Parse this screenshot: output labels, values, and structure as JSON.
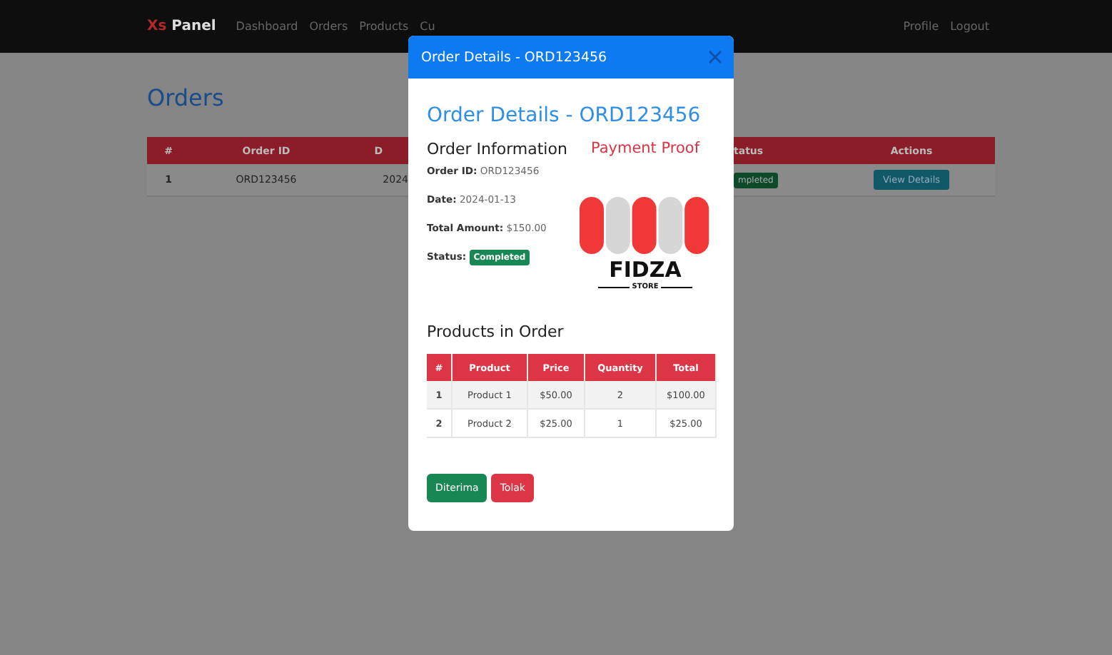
{
  "navbar": {
    "brand_prefix": "Xs",
    "brand": "Panel",
    "links": [
      {
        "label": "Dashboard"
      },
      {
        "label": "Orders"
      },
      {
        "label": "Products"
      },
      {
        "label": "Cu"
      }
    ],
    "right_links": [
      {
        "label": "Profile"
      },
      {
        "label": "Logout"
      }
    ]
  },
  "page_title": "Orders",
  "orders_table": {
    "columns": [
      "#",
      "Order ID",
      "D",
      "tatus",
      "Actions"
    ],
    "rows": [
      {
        "cells": [
          "1",
          "ORD123456",
          "2024"
        ],
        "status": "mpleted",
        "action": "View Details"
      }
    ]
  },
  "modal": {
    "title": "Order Details - ORD123456",
    "heading": "Order Details - ORD123456",
    "info_heading": "Order Information",
    "fields": [
      {
        "label": "Order ID:",
        "value": "ORD123456"
      },
      {
        "label": "Date:",
        "value": "2024-01-13"
      },
      {
        "label": "Total Amount:",
        "value": "$150.00"
      }
    ],
    "status_label": "Status:",
    "status": "Completed",
    "proof_heading": "Payment Proof",
    "logo_name": "FIDZA",
    "logo_sub": "STORE",
    "products_heading": "Products in Order",
    "products_table": {
      "columns": [
        "#",
        "Product",
        "Price",
        "Quantity",
        "Total"
      ],
      "rows": [
        [
          "1",
          "Product 1",
          "$50.00",
          "2",
          "$100.00"
        ],
        [
          "2",
          "Product 2",
          "$25.00",
          "1",
          "$25.00"
        ]
      ]
    },
    "buttons": [
      {
        "label": "Diterima",
        "kind": "accept"
      },
      {
        "label": "Tolak",
        "kind": "reject"
      }
    ]
  }
}
